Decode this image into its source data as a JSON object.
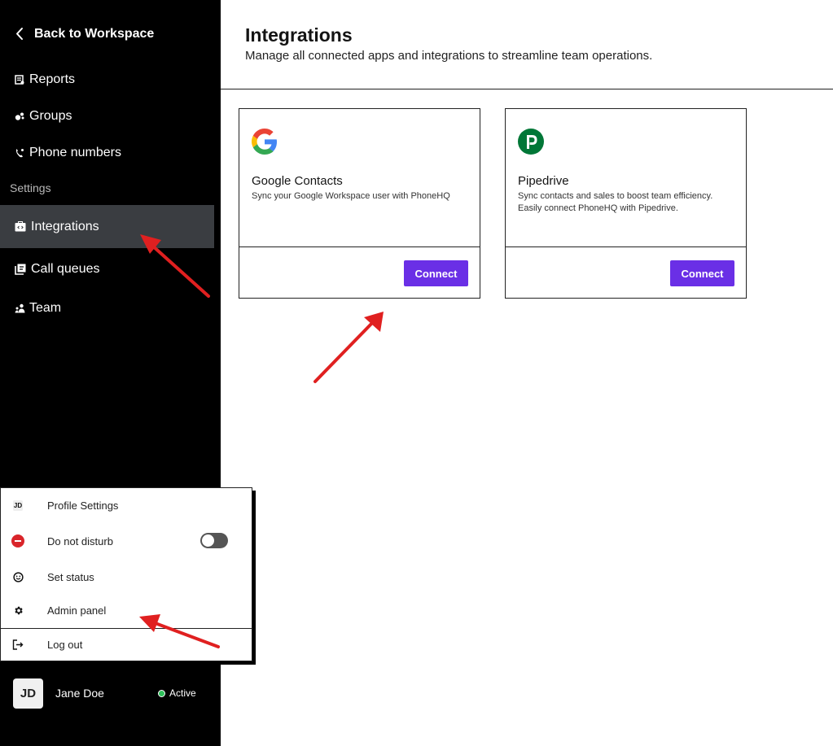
{
  "sidebar": {
    "back_label": "Back to Workspace",
    "items": [
      {
        "label": "Reports",
        "icon": "reports-icon"
      },
      {
        "label": "Groups",
        "icon": "groups-icon"
      },
      {
        "label": "Phone numbers",
        "icon": "phone-icon"
      }
    ],
    "section_label": "Settings",
    "settings_items": [
      {
        "label": "Integrations",
        "icon": "integrations-icon",
        "active": true
      },
      {
        "label": "Call queues",
        "icon": "call-queues-icon"
      },
      {
        "label": "Team",
        "icon": "team-icon"
      }
    ]
  },
  "header": {
    "title": "Integrations",
    "subtitle": "Manage all connected apps and integrations to streamline team operations."
  },
  "integrations": [
    {
      "name": "Google Contacts",
      "description": "Sync your Google Workspace user with PhoneHQ",
      "button": "Connect",
      "icon": "google-icon"
    },
    {
      "name": "Pipedrive",
      "description": "Sync contacts and sales to boost team efficiency. Easily connect PhoneHQ with Pipedrive.",
      "button": "Connect",
      "icon": "pipedrive-icon"
    }
  ],
  "menu": {
    "profile_initials": "JD",
    "profile_settings": "Profile Settings",
    "do_not_disturb": "Do not disturb",
    "do_not_disturb_on": false,
    "set_status": "Set status",
    "admin_panel": "Admin panel",
    "log_out": "Log out"
  },
  "user": {
    "initials": "JD",
    "name": "Jane Doe",
    "status": "Active",
    "status_color": "#2ec05a"
  },
  "colors": {
    "accent": "#6a2fe6",
    "annotation_arrow": "#e02020"
  }
}
